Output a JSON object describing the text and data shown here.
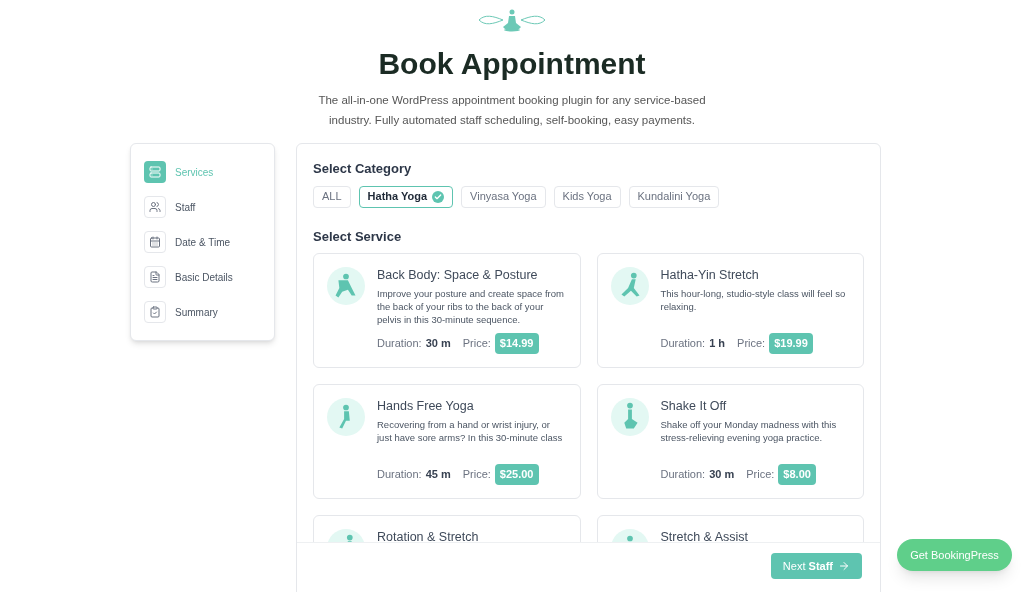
{
  "header": {
    "title": "Book Appointment",
    "subtitle": "The all-in-one WordPress appointment booking plugin for any service-based industry. Fully automated staff scheduling, self-booking, easy payments."
  },
  "steps": [
    {
      "kind": "services",
      "label": "Services",
      "selected": true
    },
    {
      "kind": "staff",
      "label": "Staff",
      "selected": false
    },
    {
      "kind": "date",
      "label": "Date & Time",
      "selected": false
    },
    {
      "kind": "details",
      "label": "Basic Details",
      "selected": false
    },
    {
      "kind": "summary",
      "label": "Summary",
      "selected": false
    }
  ],
  "category_heading": "Select Category",
  "categories": [
    {
      "label": "ALL",
      "selected": false
    },
    {
      "label": "Hatha Yoga",
      "selected": true
    },
    {
      "label": "Vinyasa Yoga",
      "selected": false
    },
    {
      "label": "Kids Yoga",
      "selected": false
    },
    {
      "label": "Kundalini Yoga",
      "selected": false
    }
  ],
  "service_heading": "Select Service",
  "services": [
    {
      "title": "Back Body: Space & Posture",
      "description": "Improve your posture and create space from the back of your ribs to the back of your pelvis in this 30-minute sequence.",
      "duration_label": "Duration:",
      "duration": "30 m",
      "price_label": "Price:",
      "price": "$14.99"
    },
    {
      "title": "Hatha-Yin Stretch",
      "description": "This hour-long, studio-style class will feel so relaxing.",
      "duration_label": "Duration:",
      "duration": "1 h",
      "price_label": "Price:",
      "price": "$19.99"
    },
    {
      "title": "Hands Free Yoga",
      "description": "Recovering from a hand or wrist injury, or just have sore arms? In this 30-minute class",
      "duration_label": "Duration:",
      "duration": "45 m",
      "price_label": "Price:",
      "price": "$25.00"
    },
    {
      "title": "Shake It Off",
      "description": "Shake off your Monday madness with this stress-relieving evening yoga practice.",
      "duration_label": "Duration:",
      "duration": "30 m",
      "price_label": "Price:",
      "price": "$8.00"
    },
    {
      "title": "Rotation & Stretch"
    },
    {
      "title": "Stretch & Assist"
    }
  ],
  "next_button": "Next **Staff**",
  "promo_button": "Get BookingPress"
}
